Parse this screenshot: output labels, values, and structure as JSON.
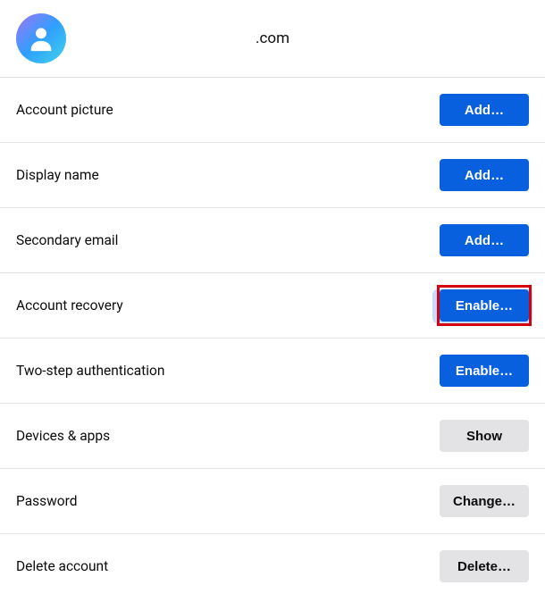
{
  "header": {
    "title": ".com"
  },
  "rows": {
    "account_picture": {
      "label": "Account picture",
      "button": "Add…"
    },
    "display_name": {
      "label": "Display name",
      "button": "Add…"
    },
    "secondary_email": {
      "label": "Secondary email",
      "button": "Add…"
    },
    "account_recovery": {
      "label": "Account recovery",
      "button": "Enable…"
    },
    "two_step": {
      "label": "Two-step authentication",
      "button": "Enable…"
    },
    "devices_apps": {
      "label": "Devices & apps",
      "button": "Show"
    },
    "password": {
      "label": "Password",
      "button": "Change…"
    },
    "delete_account": {
      "label": "Delete account",
      "button": "Delete…"
    }
  }
}
